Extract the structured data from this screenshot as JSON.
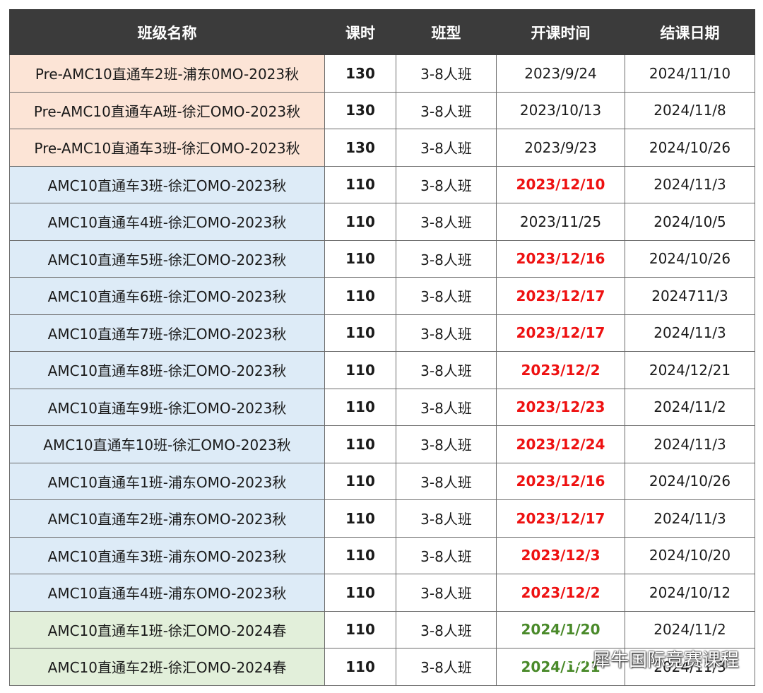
{
  "header": {
    "col_name": "班级名称",
    "col_hours": "课时",
    "col_type": "班型",
    "col_start": "开课时间",
    "col_end": "结课日期"
  },
  "colors": {
    "header_bg": "#3b3b3b",
    "orange_row": "#fce4d6",
    "blue_row": "#ddebf7",
    "green_row": "#e2efda",
    "red_date": "#ee1111",
    "green_date": "#4a8a2a"
  },
  "rows": [
    {
      "name": "Pre-AMC10直通车2班-浦东0MO-2023秋",
      "hours": "130",
      "type": "3-8人班",
      "start": "2023/9/24",
      "end": "2024/11/10"
    },
    {
      "name": "Pre-AMC10直通车A班-徐汇OMO-2023秋",
      "hours": "130",
      "type": "3-8人班",
      "start": "2023/10/13",
      "end": "2024/11/8"
    },
    {
      "name": "Pre-AMC10直通车3班-徐汇OMO-2023秋",
      "hours": "130",
      "type": "3-8人班",
      "start": "2023/9/23",
      "end": "2024/10/26"
    },
    {
      "name": "AMC10直通车3班-徐汇OMO-2023秋",
      "hours": "110",
      "type": "3-8人班",
      "start": "2023/12/10",
      "end": "2024/11/3"
    },
    {
      "name": "AMC10直通车4班-徐汇OMO-2023秋",
      "hours": "110",
      "type": "3-8人班",
      "start": "2023/11/25",
      "end": "2024/10/5"
    },
    {
      "name": "AMC10直通车5班-徐汇OMO-2023秋",
      "hours": "110",
      "type": "3-8人班",
      "start": "2023/12/16",
      "end": "2024/10/26"
    },
    {
      "name": "AMC10直通车6班-徐汇OMO-2023秋",
      "hours": "110",
      "type": "3-8人班",
      "start": "2023/12/17",
      "end": "2024711/3"
    },
    {
      "name": "AMC10直通车7班-徐汇OMO-2023秋",
      "hours": "110",
      "type": "3-8人班",
      "start": "2023/12/17",
      "end": "2024/11/3"
    },
    {
      "name": "AMC10直通车8班-徐汇OMO-2023秋",
      "hours": "110",
      "type": "3-8人班",
      "start": "2023/12/2",
      "end": "2024/12/21"
    },
    {
      "name": "AMC10直通车9班-徐汇OMO-2023秋",
      "hours": "110",
      "type": "3-8人班",
      "start": "2023/12/23",
      "end": "2024/11/2"
    },
    {
      "name": "AMC10直通车10班-徐汇OMO-2023秋",
      "hours": "110",
      "type": "3-8人班",
      "start": "2023/12/24",
      "end": "2024/11/3"
    },
    {
      "name": "AMC10直通车1班-浦东OMO-2023秋",
      "hours": "110",
      "type": "3-8人班",
      "start": "2023/12/16",
      "end": "2024/10/26"
    },
    {
      "name": "AMC10直通车2班-浦东OMO-2023秋",
      "hours": "110",
      "type": "3-8人班",
      "start": "2023/12/17",
      "end": "2024/11/3"
    },
    {
      "name": "AMC10直通车3班-浦东OMO-2023秋",
      "hours": "110",
      "type": "3-8人班",
      "start": "2023/12/3",
      "end": "2024/10/20"
    },
    {
      "name": "AMC10直通车4班-浦东OMO-2023秋",
      "hours": "110",
      "type": "3-8人班",
      "start": "2023/12/2",
      "end": "2024/10/12"
    },
    {
      "name": "AMC10直通车1班-徐汇OMO-2024春",
      "hours": "110",
      "type": "3-8人班",
      "start": "2024/1/20",
      "end": "2024/11/2"
    },
    {
      "name": "AMC10直通车2班-徐汇OMO-2024春",
      "hours": "110",
      "type": "3-8人班",
      "start": "2024/1/21",
      "end": "2024/11/3"
    }
  ],
  "watermark": {
    "text": "犀牛国际竞赛课程",
    "icon": "wechat-icon"
  }
}
